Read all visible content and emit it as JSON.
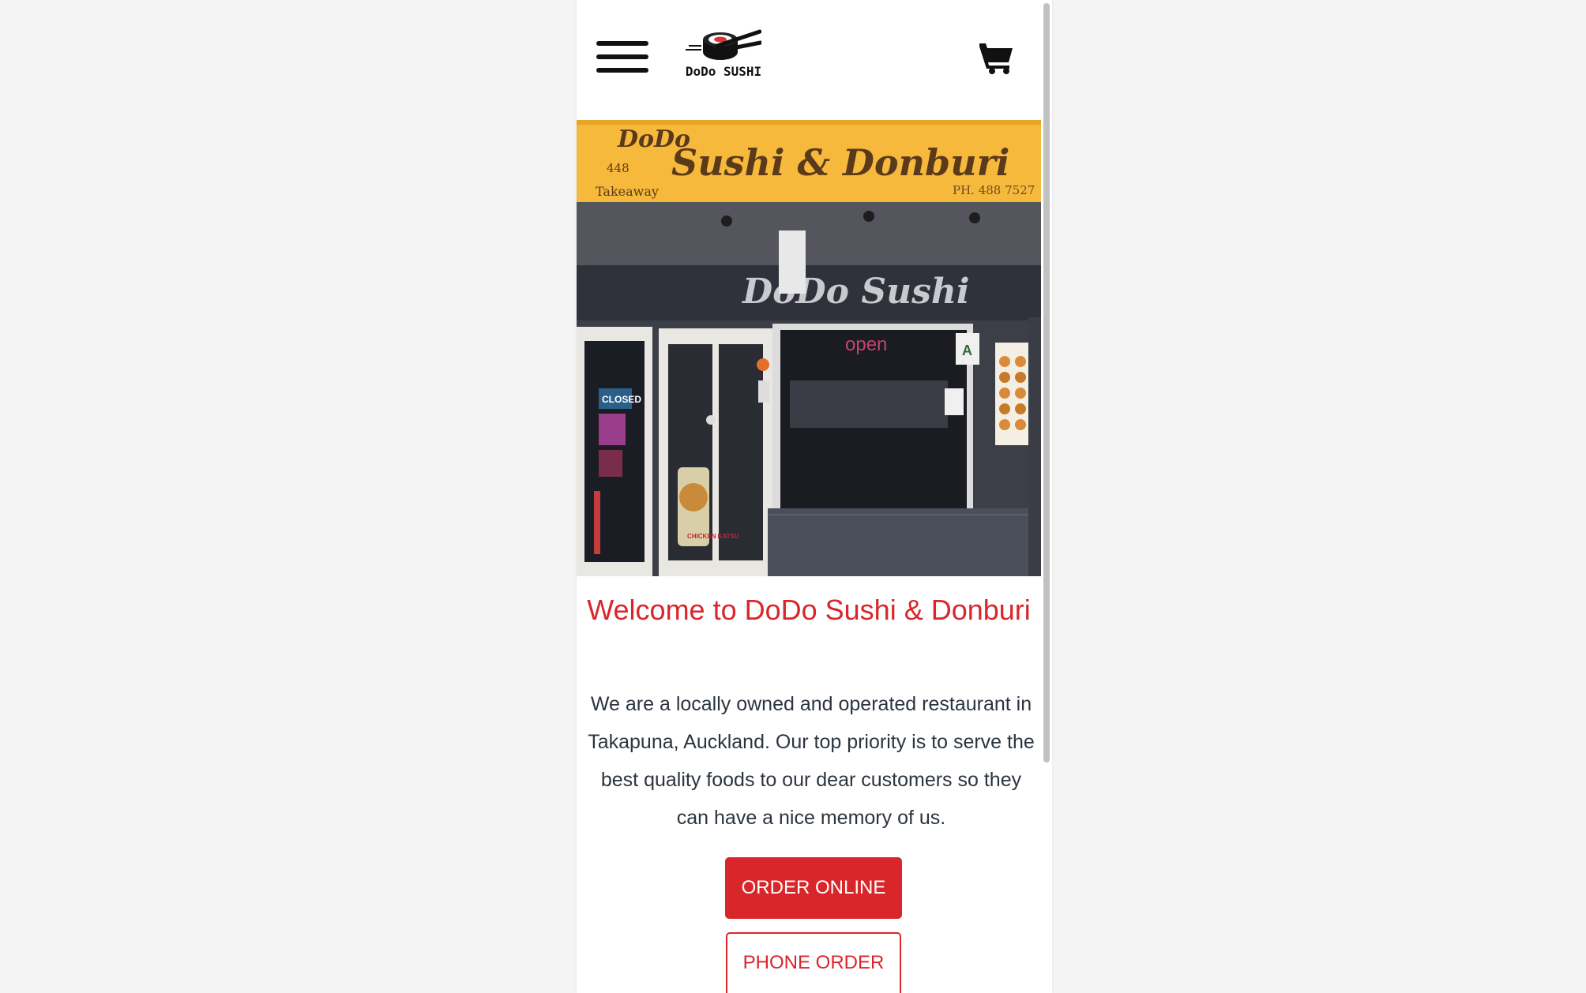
{
  "header": {
    "menu_icon": "hamburger-menu-icon",
    "logo_icon": "sushi-chopsticks-icon",
    "logo_text": "DoDo SUSHI",
    "cart_icon": "shopping-cart-icon"
  },
  "hero": {
    "sign": {
      "brand": "DoDo",
      "title": "Sushi & Donburi",
      "number": "448",
      "takeaway": "Takeaway",
      "phone": "PH. 488 7527"
    },
    "storefront_sign": "DoDo Sushi",
    "open_sign": "open",
    "closed_sign": "CLOSED",
    "poster_text": "CHICKEN KATSU",
    "grade_badge": "A"
  },
  "main": {
    "welcome_title": "Welcome to DoDo Sushi & Donburi",
    "intro_text": "We are a locally owned and operated restaurant in Takapuna, Auckland. Our top priority is to serve the best quality foods to our dear customers so they can have a nice memory of us.",
    "order_online_label": "ORDER ONLINE",
    "phone_order_label": "PHONE ORDER"
  },
  "colors": {
    "accent": "#d9262b",
    "text": "#2c3440",
    "sign_yellow": "#f6b93b",
    "background": "#f4f4f4"
  }
}
